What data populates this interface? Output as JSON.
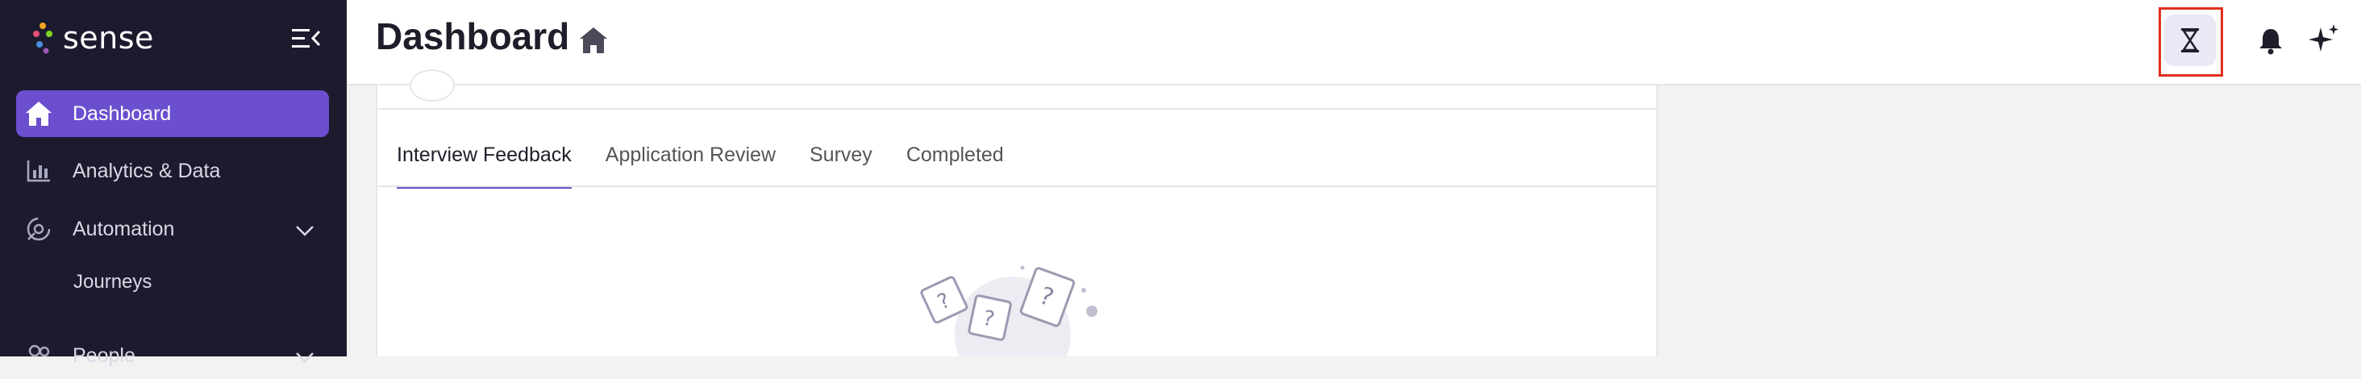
{
  "brand": {
    "name": "sense"
  },
  "sidebar": {
    "items": [
      {
        "label": "Dashboard",
        "icon": "home-icon",
        "active": true
      },
      {
        "label": "Analytics & Data",
        "icon": "bar-chart-icon"
      },
      {
        "label": "Automation",
        "icon": "automation-icon",
        "expandable": true
      },
      {
        "label": "Journeys",
        "sub": true
      },
      {
        "label": "People",
        "icon": "people-icon",
        "expandable": true
      }
    ]
  },
  "header": {
    "title": "Dashboard",
    "title_icon": "home-icon",
    "actions": [
      "hourglass-icon",
      "bell-icon",
      "sparkle-icon"
    ]
  },
  "main": {
    "tabs": [
      {
        "label": "Interview Feedback",
        "active": true
      },
      {
        "label": "Application Review"
      },
      {
        "label": "Survey"
      },
      {
        "label": "Completed"
      }
    ]
  },
  "colors": {
    "sidebar_bg": "#1c1b2e",
    "accent": "#6b4fcf",
    "highlight": "#e0301e"
  }
}
